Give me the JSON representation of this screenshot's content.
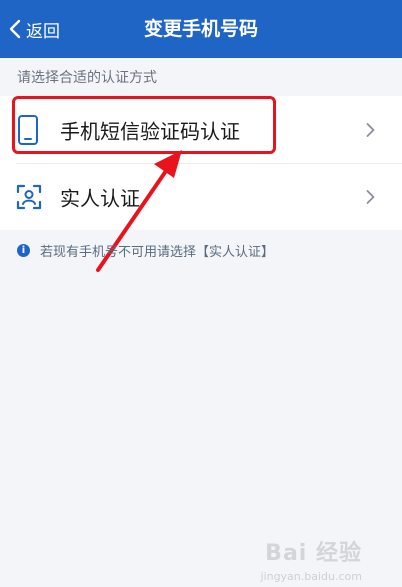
{
  "nav": {
    "back_label": "返回",
    "title": "变更手机号码"
  },
  "section_hint": "请选择合适的认证方式",
  "options": [
    {
      "label": "手机短信验证码认证",
      "icon": "phone-icon"
    },
    {
      "label": "实人认证",
      "icon": "face-scan-icon"
    }
  ],
  "info_text": "若现有手机号不可用请选择【实人认证】",
  "annotation": {
    "color": "#e8131d",
    "highlighted_option": "手机短信验证码认证"
  },
  "watermark": {
    "text": "Bai 经验",
    "sub": "jingyan.baidu.com"
  },
  "colors": {
    "accent": "#1f65c6",
    "background": "#f3f5f9"
  }
}
